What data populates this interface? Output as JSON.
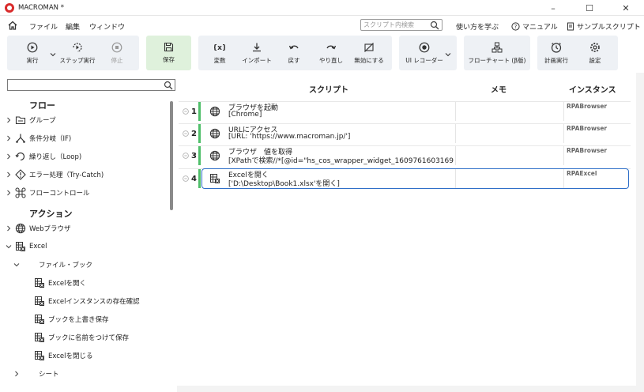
{
  "window": {
    "title": "MACROMAN *",
    "controls": {
      "minimize": "–",
      "maximize": "☐",
      "close": "✕"
    }
  },
  "menubar": {
    "items": [
      "ファイル",
      "編集",
      "ウィンドウ"
    ],
    "search_placeholder": "スクリプト内検索",
    "help_links": {
      "learn": "使い方を学ぶ",
      "manual": "マニュアル",
      "samples": "サンプルスクリプト"
    }
  },
  "toolbar": {
    "run": "実行",
    "step_run": "ステップ実行",
    "stop": "停止",
    "save": "保存",
    "variables": "変数",
    "import": "インポート",
    "undo": "戻す",
    "redo": "やり直し",
    "disable": "無効にする",
    "ui_recorder": "UI レコーダー",
    "flowchart": "フローチャート (β版)",
    "schedule": "計画実行",
    "settings": "設定"
  },
  "left_panel": {
    "search_placeholder": "",
    "flow_heading": "フロー",
    "flow_items": [
      "グループ",
      "条件分岐（IF)",
      "繰り返し（Loop)",
      "エラー処理（Try-Catch)",
      "フローコントロール"
    ],
    "action_heading": "アクション",
    "action_items": {
      "web_browser": "Webブラウザ",
      "excel": "Excel",
      "file_book": "ファイル・ブック",
      "excel_children": [
        "Excelを開く",
        "Excelインスタンスの存在確認",
        "ブックを上書き保存",
        "ブックに名前をつけて保存",
        "Excelを閉じる"
      ],
      "sheet": "シート"
    }
  },
  "main_panel": {
    "columns": {
      "script": "スクリプト",
      "memo": "メモ",
      "instance": "インスタンス"
    },
    "rows": [
      {
        "num": "1",
        "title": "ブラウザを起動",
        "detail": "[Chrome]",
        "memo": "",
        "instance": "RPABrowser",
        "icon": "globe-icon"
      },
      {
        "num": "2",
        "title": "URLにアクセス",
        "detail": "[URL: 'https://www.macroman.jp/']",
        "memo": "",
        "instance": "RPABrowser",
        "icon": "globe-icon"
      },
      {
        "num": "3",
        "title": "ブラウザ　値を取得",
        "detail": "[XPathで検索//*[@id=\"hs_cos_wrapper_widget_1609761603169",
        "memo": "",
        "instance": "RPABrowser",
        "icon": "globe-icon"
      },
      {
        "num": "4",
        "title": "Excelを開く",
        "detail": "['D:\\Desktop\\Book1.xlsx'を開く]",
        "memo": "",
        "instance": "RPAExcel",
        "icon": "excel-icon"
      }
    ]
  }
}
